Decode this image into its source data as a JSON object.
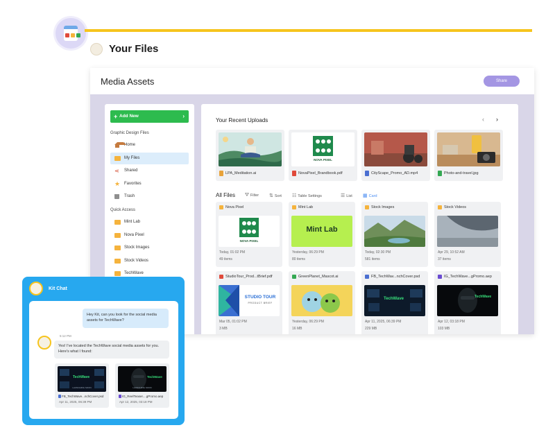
{
  "page": {
    "title": "Your Files"
  },
  "window": {
    "title": "Media Assets",
    "share_label": "Share"
  },
  "sidebar": {
    "add_new_label": "Add New",
    "section_graphic": "Graphic Design Files",
    "items": [
      {
        "label": "Home",
        "icon": "home-icon"
      },
      {
        "label": "My Files",
        "icon": "folder-icon",
        "active": true
      },
      {
        "label": "Shared",
        "icon": "share-icon"
      },
      {
        "label": "Favorites",
        "icon": "star-icon"
      },
      {
        "label": "Trash",
        "icon": "trash-icon"
      }
    ],
    "section_quick": "Quick Access",
    "quick": [
      {
        "label": "Mint Lab"
      },
      {
        "label": "Nova Pixel"
      },
      {
        "label": "Stock Images"
      },
      {
        "label": "Stock Videos"
      },
      {
        "label": "TechWave"
      }
    ]
  },
  "recent": {
    "title": "Your Recent Uploads",
    "items": [
      {
        "name": "LPA_Meditation.ai",
        "icon_color": "#e8a33b"
      },
      {
        "name": "NovaPixel_Brandbook.pdf",
        "icon_color": "#e04a3b"
      },
      {
        "name": "CityScape_Promo_AD.mp4",
        "icon_color": "#4b6fd1"
      },
      {
        "name": "Photo-and-travel.jpg",
        "icon_color": "#34a853"
      }
    ],
    "nova_logo_text": "NOVA PIXEL"
  },
  "all_files": {
    "title": "All Files",
    "tools": {
      "filter": "Filter",
      "sort": "Sort",
      "table_settings": "Table Settings",
      "list": "List",
      "card": "Card"
    },
    "items": [
      {
        "name": "Nova Pixel",
        "meta1": "Today, 01:02 PM",
        "meta2": "49 items"
      },
      {
        "name": "Mint Lab",
        "meta1": "Yesterday, 06:29 PM",
        "meta2": "80 items",
        "thumb_text": "Mint Lab"
      },
      {
        "name": "Stock Images",
        "meta1": "Today, 02:30 PM",
        "meta2": "581 items"
      },
      {
        "name": "Stock Videos",
        "meta1": "Apr 29, 10:52 AM",
        "meta2": "37 items"
      },
      {
        "name": "StudioTour_Prod...tBrief.pdf",
        "meta1": "Mar 05, 01:02 PM",
        "meta2": "3 MB",
        "thumb_text": "STUDIO TOUR",
        "thumb_sub": "PRODUCT BRIEF"
      },
      {
        "name": "GreenPlanet_Mascot.ai",
        "meta1": "Yesterday, 06:29 PM",
        "meta2": "16 MB"
      },
      {
        "name": "FB_TechWav...nchCover.psd",
        "meta1": "Apr 11, 2025, 06:39 PM",
        "meta2": "229 MB",
        "thumb_text": "TechWave"
      },
      {
        "name": "IG_TechWave...gPromo.aep",
        "meta1": "Apr 12, 03:18 PM",
        "meta2": "103 MB",
        "thumb_text": "TechWave"
      }
    ]
  },
  "chat": {
    "title": "Kit Chat",
    "user_message": "Hey Kit, can you look for the social media assets for TechWave?",
    "time": "5:12 PM",
    "bot_message": "Yes! I've located the TechWave social media assets for you. Here's what I found:",
    "attachments": [
      {
        "name": "FB_TechWave...nchCover.psd",
        "date": "Apr 11, 2025, 06:39 PM",
        "thumb_text": "TechWave",
        "thumb_sub": "LAUNCHING SOON"
      },
      {
        "name": "IG_ReelTeaser....gPromo.aep",
        "date": "Apr 12, 2025, 03:18 PM",
        "thumb_text": "TechWave",
        "thumb_sub": "LAUNCHING SOON"
      }
    ]
  },
  "colors": {
    "accent": "#f6c41d",
    "primary": "#2dbb4e",
    "share": "#a496e3",
    "chat": "#27a8ef"
  }
}
